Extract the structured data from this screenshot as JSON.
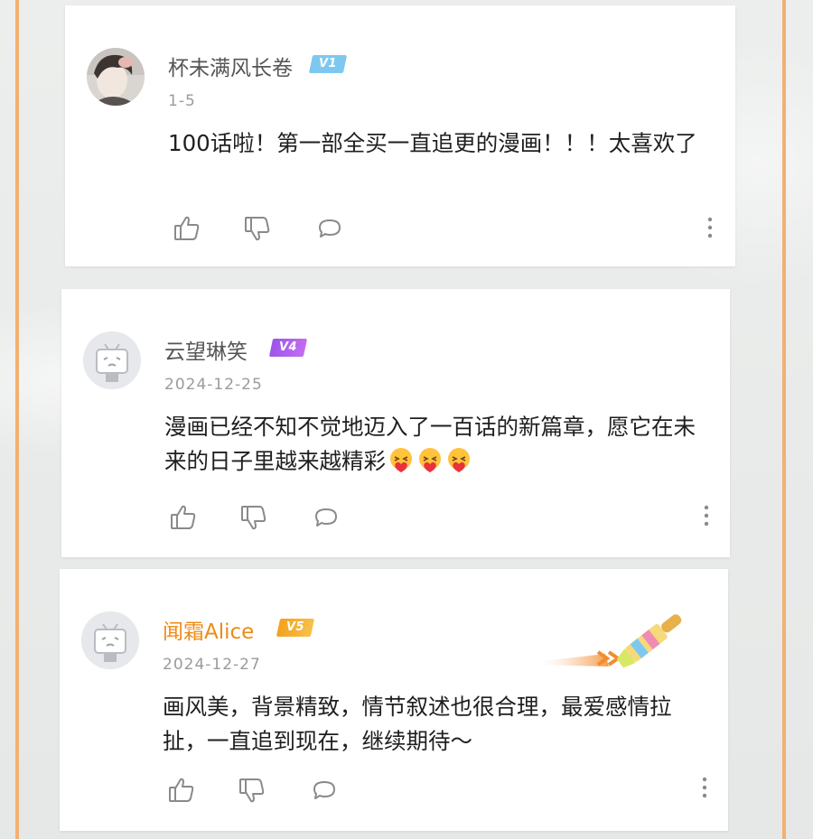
{
  "comments": [
    {
      "username": "杯未满风长卷",
      "level": "V1",
      "date": "1-5",
      "text": "100话啦！第一部全买一直追更的漫画！！！太喜欢了"
    },
    {
      "username": "云望琳笑",
      "level": "V4",
      "date": "2024-12-25",
      "text": "漫画已经不知不觉地迈入了一百话的新篇章，愿它在未来的日子里越来越精彩",
      "emojis": [
        "heart-hug-emoji",
        "heart-hug-emoji",
        "heart-hug-emoji"
      ]
    },
    {
      "username": "闻霜Alice",
      "level": "V5",
      "date": "2024-12-27",
      "text": "画风美，背景精致，情节叙述也很合理，最爱感情拉扯，一直追到现在，继续期待～",
      "badge": "paintbrush-decoration"
    }
  ],
  "actions": [
    "like-icon",
    "dislike-icon",
    "reply-icon",
    "more-icon"
  ],
  "colors": {
    "frame": "#f3b072",
    "vip_name": "#ee8a14",
    "v1": "#7ec8ef",
    "v4": "#a95ce9",
    "v5": "#f5b02e"
  }
}
